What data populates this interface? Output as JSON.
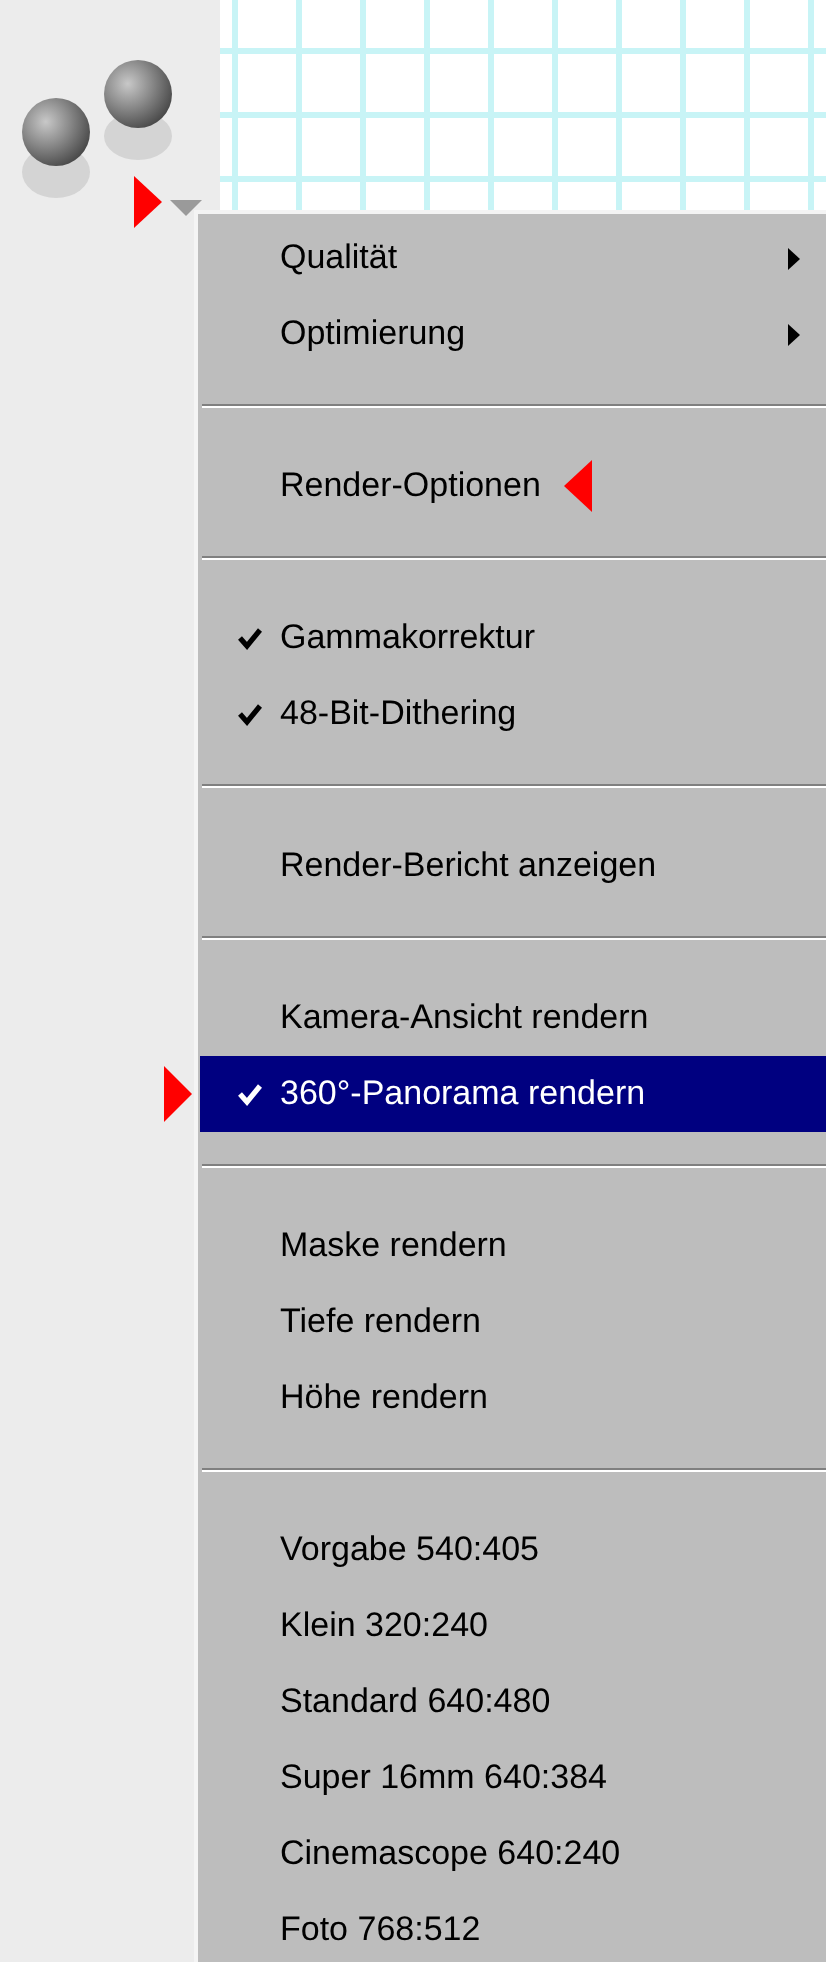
{
  "menu": {
    "groups": [
      {
        "items": [
          {
            "label": "Qualität",
            "checked": false,
            "submenu": true,
            "selected": false,
            "arrow_before": false,
            "arrow_after": false
          },
          {
            "label": "Optimierung",
            "checked": false,
            "submenu": true,
            "selected": false,
            "arrow_before": false,
            "arrow_after": false
          }
        ]
      },
      {
        "items": [
          {
            "label": "Render-Optionen",
            "checked": false,
            "submenu": false,
            "selected": false,
            "arrow_before": false,
            "arrow_after": true
          }
        ]
      },
      {
        "items": [
          {
            "label": "Gammakorrektur",
            "checked": true,
            "submenu": false,
            "selected": false,
            "arrow_before": false,
            "arrow_after": false
          },
          {
            "label": "48-Bit-Dithering",
            "checked": true,
            "submenu": false,
            "selected": false,
            "arrow_before": false,
            "arrow_after": false
          }
        ]
      },
      {
        "items": [
          {
            "label": "Render-Bericht anzeigen",
            "checked": false,
            "submenu": false,
            "selected": false,
            "arrow_before": false,
            "arrow_after": false
          }
        ]
      },
      {
        "items": [
          {
            "label": "Kamera-Ansicht rendern",
            "checked": false,
            "submenu": false,
            "selected": false,
            "arrow_before": false,
            "arrow_after": false
          },
          {
            "label": "360°-Panorama rendern",
            "checked": true,
            "submenu": false,
            "selected": true,
            "arrow_before": true,
            "arrow_after": false
          }
        ]
      },
      {
        "items": [
          {
            "label": "Maske rendern",
            "checked": false,
            "submenu": false,
            "selected": false,
            "arrow_before": false,
            "arrow_after": false
          },
          {
            "label": "Tiefe rendern",
            "checked": false,
            "submenu": false,
            "selected": false,
            "arrow_before": false,
            "arrow_after": false
          },
          {
            "label": "Höhe rendern",
            "checked": false,
            "submenu": false,
            "selected": false,
            "arrow_before": false,
            "arrow_after": false
          }
        ]
      },
      {
        "items": [
          {
            "label": "Vorgabe 540:405",
            "checked": false,
            "submenu": false,
            "selected": false,
            "arrow_before": false,
            "arrow_after": false
          },
          {
            "label": "Klein 320:240",
            "checked": false,
            "submenu": false,
            "selected": false,
            "arrow_before": false,
            "arrow_after": false
          },
          {
            "label": "Standard 640:480",
            "checked": false,
            "submenu": false,
            "selected": false,
            "arrow_before": false,
            "arrow_after": false
          },
          {
            "label": "Super 16mm 640:384",
            "checked": false,
            "submenu": false,
            "selected": false,
            "arrow_before": false,
            "arrow_after": false
          },
          {
            "label": "Cinemascope 640:240",
            "checked": false,
            "submenu": false,
            "selected": false,
            "arrow_before": false,
            "arrow_after": false
          },
          {
            "label": "Foto 768:512",
            "checked": false,
            "submenu": false,
            "selected": false,
            "arrow_before": false,
            "arrow_after": false
          }
        ]
      }
    ]
  }
}
